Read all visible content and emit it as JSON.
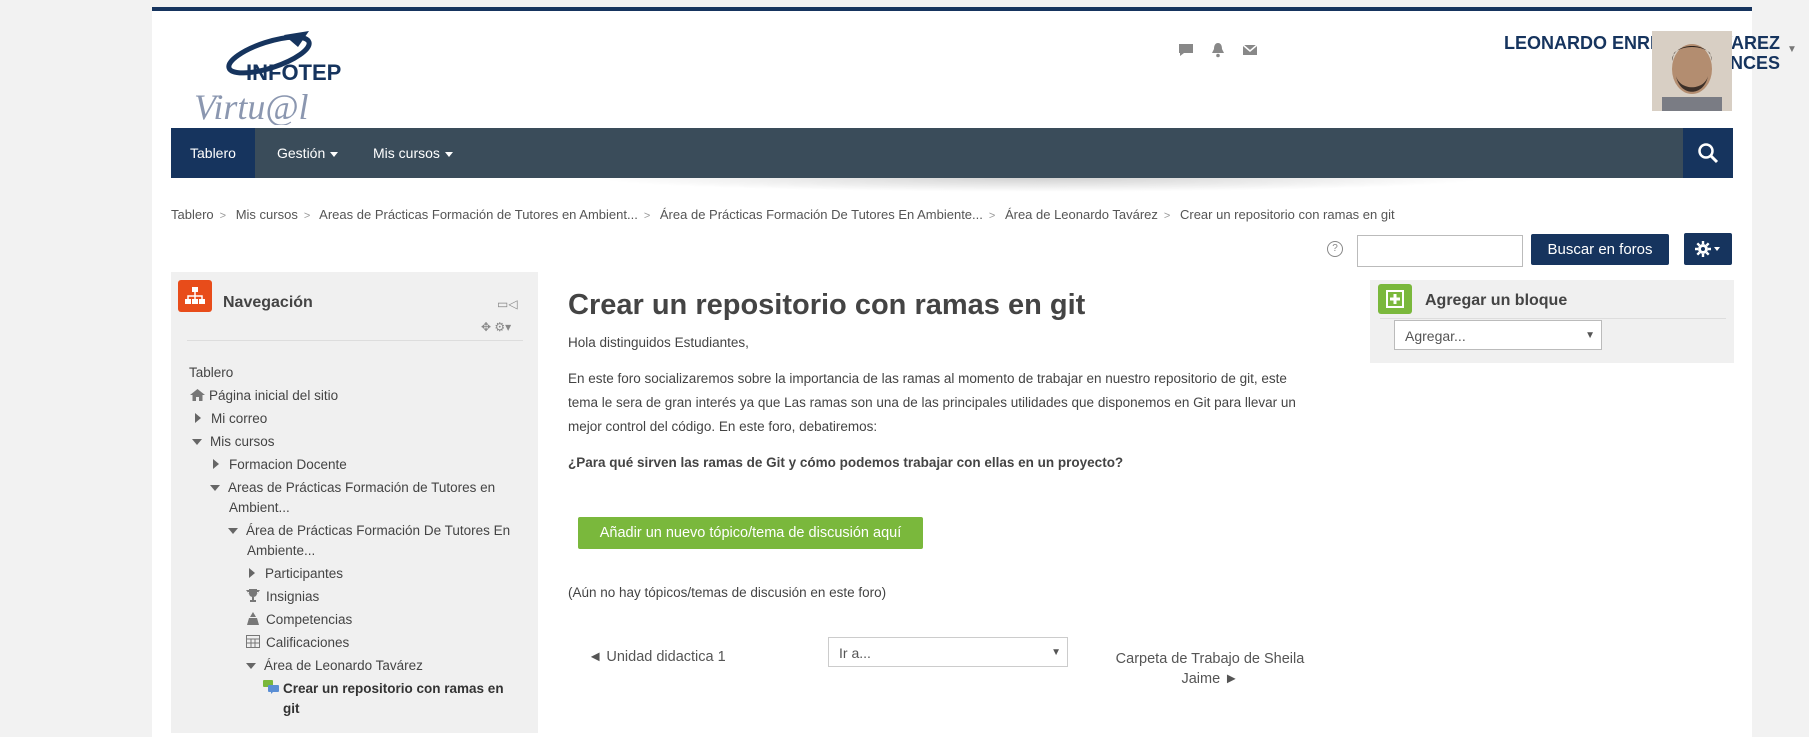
{
  "header": {
    "logo_top": "INFOTEP",
    "logo_bottom": "Virtu@l",
    "user_name_line1": "LEONARDO ENRIQUE TAVAREZ",
    "user_name_line2": "BETANCES",
    "icons": [
      "chat-icon",
      "bell-icon",
      "envelope-icon"
    ]
  },
  "navbar": {
    "items": [
      {
        "label": "Tablero"
      },
      {
        "label": "Gestión"
      },
      {
        "label": "Mis cursos"
      }
    ]
  },
  "breadcrumb": [
    "Tablero",
    "Mis cursos",
    "Areas de Prácticas Formación de Tutores en Ambient...",
    "Área de Prácticas Formación De Tutores En Ambiente...",
    "Área de Leonardo Tavárez",
    "Crear un repositorio con ramas en git"
  ],
  "search": {
    "button_label": "Buscar en foros",
    "value": ""
  },
  "navigation": {
    "title": "Navegación",
    "items": [
      {
        "label": "Tablero"
      },
      {
        "label": "Página inicial del sitio"
      },
      {
        "label": "Mi correo"
      },
      {
        "label": "Mis cursos"
      },
      {
        "label": "Formacion Docente"
      },
      {
        "label": "Areas de Prácticas Formación de Tutores en"
      },
      {
        "label": "Ambient..."
      },
      {
        "label": "Área de Prácticas Formación De Tutores En"
      },
      {
        "label": "Ambiente..."
      },
      {
        "label": "Participantes"
      },
      {
        "label": "Insignias"
      },
      {
        "label": "Competencias"
      },
      {
        "label": "Calificaciones"
      },
      {
        "label": "Área de Leonardo Tavárez"
      },
      {
        "label": "Crear un repositorio con ramas en"
      },
      {
        "label": "git"
      }
    ]
  },
  "forum": {
    "title": "Crear un repositorio con ramas en git",
    "greeting": "Hola distinguidos Estudiantes,",
    "intro_line1": "En este foro socializaremos sobre la importancia de las ramas al momento de trabajar en nuestro repositorio de git, este",
    "intro_line2": "tema le sera de gran interés ya que Las ramas son una de las principales utilidades que disponemos en Git para llevar un",
    "intro_line3": "mejor control del código. En este foro, debatiremos:",
    "question": "¿Para qué sirven las ramas de Git y cómo podemos trabajar con ellas en un proyecto?",
    "add_button": "Añadir un nuevo tópico/tema de discusión aquí",
    "empty_note": "(Aún no hay tópicos/temas de discusión en este foro)",
    "prev_link": "◄ Unidad didactica 1",
    "goto_select": "Ir a...",
    "next_link_line1": "Carpeta de Trabajo de Sheila",
    "next_link_line2": "Jaime ►"
  },
  "add_block": {
    "title": "Agregar un bloque",
    "select": "Agregar..."
  },
  "colors": {
    "brand_navy": "#16345e",
    "navbar_gray": "#3a4c5a",
    "accent_green": "#7ab83c",
    "nav_orange": "#e84c1a"
  }
}
